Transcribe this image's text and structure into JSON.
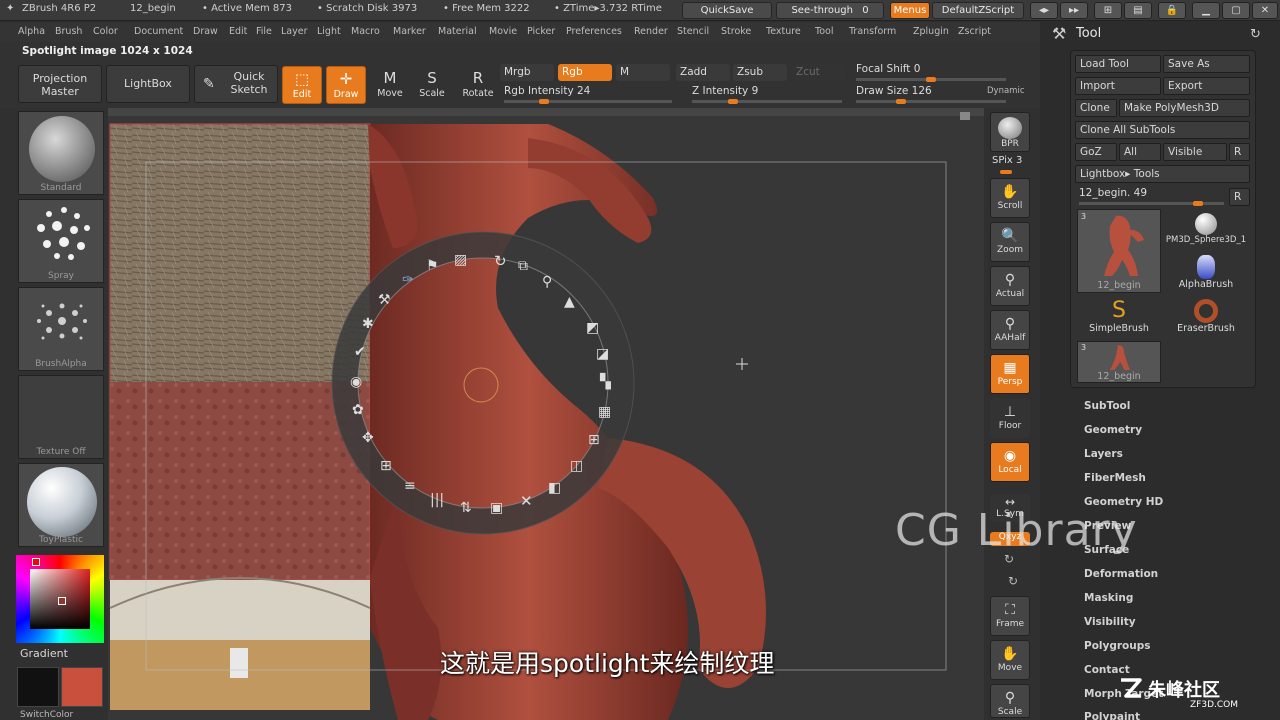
{
  "titlebar": {
    "app": "ZBrush 4R6 P2",
    "doc": "12_begin",
    "active_mem": "• Active Mem 873",
    "scratch_disk": "• Scratch Disk 3973",
    "free_mem": "• Free Mem 3222",
    "ztime": "• ZTime▸3.732 RTime",
    "quicksave": "QuickSave",
    "seethrough": "See-through",
    "seethrough_value": "0",
    "menus": "Menus",
    "script": "DefaultZScript"
  },
  "menubar": [
    "Alpha",
    "Brush",
    "Color",
    "Document",
    "Draw",
    "Edit",
    "File",
    "Layer",
    "Light",
    "Macro",
    "Marker",
    "Material",
    "Movie",
    "Picker",
    "Preferences",
    "Render",
    "Stencil",
    "Stroke",
    "Texture",
    "Tool",
    "Transform",
    "Zplugin",
    "Zscript"
  ],
  "toolbar": {
    "spotlight_label": "Spotlight image 1024 x 1024",
    "projection_master": "Projection Master",
    "lightbox": "LightBox",
    "quick_sketch": "Quick Sketch",
    "edit": "Edit",
    "draw": "Draw",
    "move": "Move",
    "scale": "Scale",
    "rotate": "Rotate",
    "mrgb": "Mrgb",
    "rgb": "Rgb",
    "m": "M",
    "zadd": "Zadd",
    "zsub": "Zsub",
    "zcut": "Zcut",
    "rgb_intensity": "Rgb Intensity 24",
    "z_intensity": "Z Intensity 9",
    "focal_shift": "Focal Shift 0",
    "draw_size": "Draw Size 126",
    "dynamic": "Dynamic",
    "rgb_intensity_pct": 24,
    "z_intensity_pct": 9,
    "focal_shift_pct": 50,
    "draw_size_pct": 30
  },
  "leftshelf": {
    "brush_standard": "Standard",
    "brush_spray": "Spray",
    "brush_alpha": "BrushAlpha",
    "texture_off": "Texture Off",
    "material": "ToyPlastic",
    "gradient": "Gradient",
    "switchcolor": "SwitchColor"
  },
  "rightcol": {
    "bpr": "BPR",
    "spix": "SPix 3",
    "scroll": "Scroll",
    "zoom": "Zoom",
    "actual": "Actual",
    "aahalf": "AAHalf",
    "persp": "Persp",
    "floor": "Floor",
    "local": "Local",
    "lsym": "L.Sym",
    "xyz": "Qxyz",
    "frame": "Frame",
    "move": "Move",
    "scale": "Scale"
  },
  "toolpanel": {
    "title": "Tool",
    "load_tool": "Load Tool",
    "save_as": "Save As",
    "import": "Import",
    "export": "Export",
    "clone": "Clone",
    "make_polymesh": "Make PolyMesh3D",
    "clone_all": "Clone All SubTools",
    "goz": "GoZ",
    "all": "All",
    "visible": "Visible",
    "r": "R",
    "lightbox_tools": "Lightbox▸ Tools",
    "current_tool": "12_begin. 49",
    "current_tool_pct": 82,
    "thumbs": [
      {
        "label": "12_begin",
        "count": "3"
      },
      {
        "label": "PM3D_Sphere3D_1"
      },
      {
        "label": "AlphaBrush"
      },
      {
        "label": "SimpleBrush"
      },
      {
        "label": "EraserBrush"
      },
      {
        "label": "12_begin",
        "count": "3"
      }
    ],
    "menu": [
      "SubTool",
      "Geometry",
      "Layers",
      "FiberMesh",
      "Geometry HD",
      "Preview",
      "Surface",
      "Deformation",
      "Masking",
      "Visibility",
      "Polygroups",
      "Contact",
      "Morph Target",
      "Polypaint"
    ]
  },
  "overlay": {
    "watermark": "CG Library",
    "subtitle": "这就是用spotlight来绘制纹理",
    "logo": "朱峰社区",
    "logo_url": "ZF3D.COM"
  },
  "colors": {
    "accent": "#e87b1e",
    "primary_color": "#ffffff",
    "secondary_color": "#c8503c"
  }
}
